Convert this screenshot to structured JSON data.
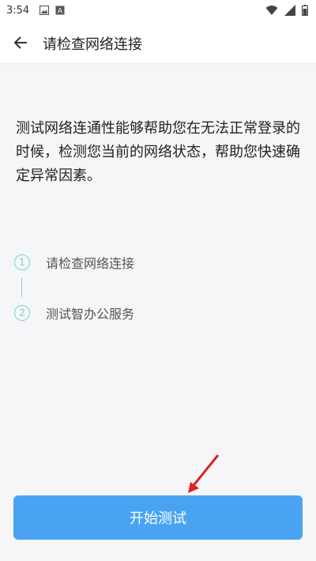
{
  "status_bar": {
    "time": "3:54",
    "left_icons": [
      "image-icon",
      "a-icon"
    ],
    "right_icons": [
      "wifi-icon",
      "signal-icon",
      "battery-icon"
    ]
  },
  "header": {
    "title": "请检查网络连接",
    "back_icon": "arrow-left-icon"
  },
  "description": "测试网络连通性能够帮助您在无法正常登录的时候，检测您当前的网络状态，帮助您快速确定异常因素。",
  "steps": [
    {
      "number": "1",
      "label": "请检查网络连接"
    },
    {
      "number": "2",
      "label": "测试智办公服务"
    }
  ],
  "action": {
    "start_label": "开始测试"
  },
  "colors": {
    "accent": "#4aa3f2",
    "step": "#7ad3cf",
    "annotation": "#e02020"
  }
}
